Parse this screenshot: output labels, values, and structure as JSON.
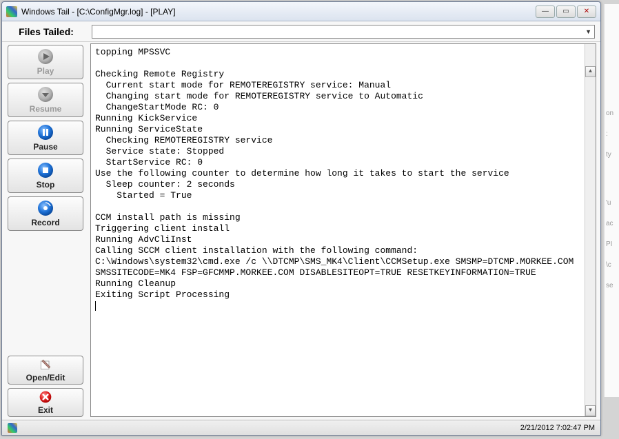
{
  "window": {
    "title": "Windows Tail - [C:\\ConfigMgr.log] - [PLAY]"
  },
  "toolbar": {
    "files_label": "Files Tailed:",
    "dropdown_value": ""
  },
  "buttons": {
    "play": "Play",
    "resume": "Resume",
    "pause": "Pause",
    "stop": "Stop",
    "record": "Record",
    "openedit": "Open/Edit",
    "exit": "Exit"
  },
  "log": "topping MPSSVC\n\nChecking Remote Registry\n  Current start mode for REMOTEREGISTRY service: Manual\n  Changing start mode for REMOTEREGISTRY service to Automatic\n  ChangeStartMode RC: 0\nRunning KickService\nRunning ServiceState\n  Checking REMOTEREGISTRY service\n  Service state: Stopped\n  StartService RC: 0\nUse the following counter to determine how long it takes to start the service\n  Sleep counter: 2 seconds\n    Started = True\n\nCCM install path is missing\nTriggering client install\nRunning AdvCliInst\nCalling SCCM client installation with the following command:\nC:\\Windows\\system32\\cmd.exe /c \\\\DTCMP\\SMS_MK4\\Client\\CCMSetup.exe SMSMP=DTCMP.MORKEE.COM\nSMSSITECODE=MK4 FSP=GFCMMP.MORKEE.COM DISABLESITEOPT=TRUE RESETKEYINFORMATION=TRUE\nRunning Cleanup\nExiting Script Processing",
  "status": {
    "datetime": "2/21/2012 7:02:47 PM"
  },
  "background_fragments": [
    "on",
    ":",
    "ty",
    "'u",
    "ac",
    "PI",
    "\\c",
    "se"
  ]
}
